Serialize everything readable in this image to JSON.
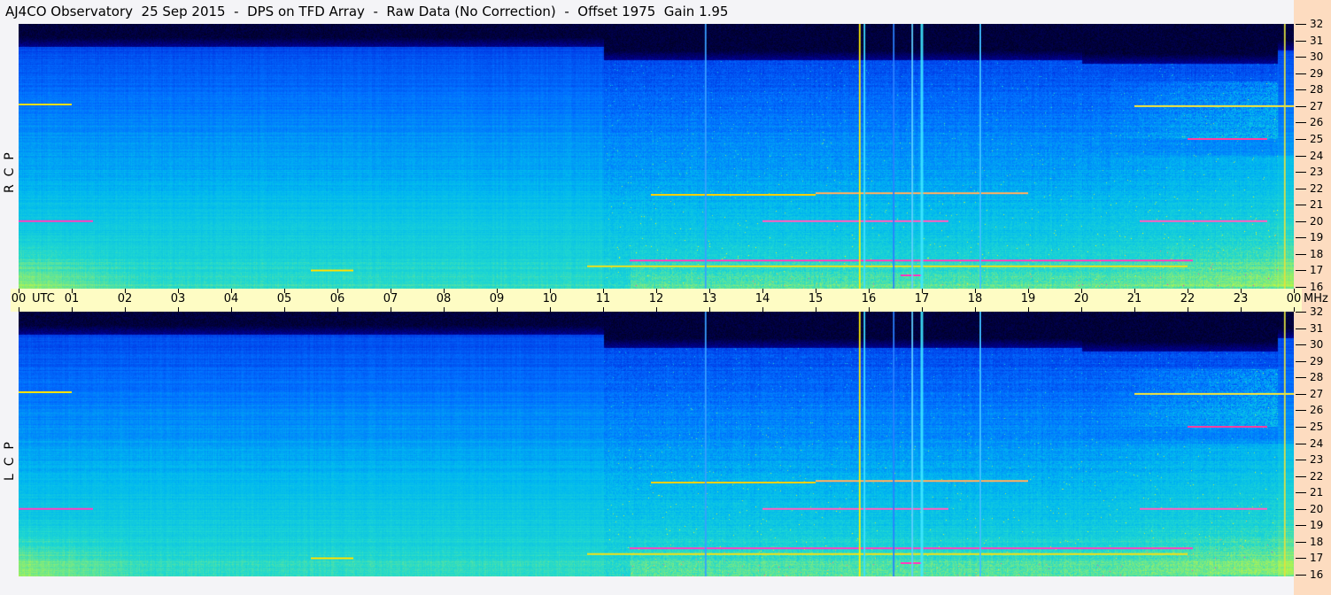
{
  "title": "AJ4CO Observatory  25 Sep 2015  -  DPS on TFD Array  -  Raw Data (No Correction)  -  Offset 1975  Gain 1.95",
  "chart_data": {
    "type": "heatmap",
    "title": "AJ4CO Observatory  25 Sep 2015  -  DPS on TFD Array  -  Raw Data (No Correction)  -  Offset 1975  Gain 1.95",
    "panels": [
      {
        "label": "R  C  P",
        "polarization": "RCP"
      },
      {
        "label": "L  C  P",
        "polarization": "LCP"
      }
    ],
    "x_unit_label": "UTC",
    "y_unit_label": "MHz",
    "x_range_utc_hours": [
      0,
      24
    ],
    "y_range_mhz": [
      16,
      32
    ],
    "x_ticks": [
      "00",
      "01",
      "02",
      "03",
      "04",
      "05",
      "06",
      "07",
      "08",
      "09",
      "10",
      "11",
      "12",
      "13",
      "14",
      "15",
      "16",
      "17",
      "18",
      "19",
      "20",
      "21",
      "22",
      "23",
      "00"
    ],
    "y_ticks": [
      "32",
      "31",
      "30",
      "29",
      "28",
      "27",
      "26",
      "25",
      "24",
      "23",
      "22",
      "21",
      "20",
      "19",
      "18",
      "17",
      "16"
    ],
    "colormap": [
      "#000010",
      "#00008a",
      "#0030e0",
      "#0070ff",
      "#00b8f0",
      "#20d8d0",
      "#a0f060",
      "#ffff00",
      "#ff00ff"
    ],
    "vertical_interference_utc": [
      {
        "utc": 12.93,
        "color": "#3aa0ff"
      },
      {
        "utc": 15.83,
        "color": "#ffee00"
      },
      {
        "utc": 15.92,
        "color": "#40e0ff"
      },
      {
        "utc": 16.47,
        "color": "#2a80ff"
      },
      {
        "utc": 16.82,
        "color": "#60d0ff"
      },
      {
        "utc": 17.0,
        "color": "#40e8ff"
      },
      {
        "utc": 18.1,
        "color": "#40c0ff"
      },
      {
        "utc": 23.83,
        "color": "#e0e040"
      }
    ],
    "horizontal_signals": [
      {
        "freq_mhz": 27.1,
        "start_utc": 0.0,
        "end_utc": 1.0,
        "color": "#ffe000"
      },
      {
        "freq_mhz": 20.0,
        "start_utc": 0.0,
        "end_utc": 1.4,
        "color": "#ff40c0"
      },
      {
        "freq_mhz": 17.6,
        "start_utc": 11.5,
        "end_utc": 22.1,
        "color": "#ff40c0"
      },
      {
        "freq_mhz": 17.25,
        "start_utc": 10.7,
        "end_utc": 22.0,
        "color": "#e8e020"
      },
      {
        "freq_mhz": 21.6,
        "start_utc": 11.9,
        "end_utc": 15.0,
        "color": "#ffd000"
      },
      {
        "freq_mhz": 21.7,
        "start_utc": 15.0,
        "end_utc": 19.0,
        "color": "#ffb060"
      },
      {
        "freq_mhz": 20.0,
        "start_utc": 14.0,
        "end_utc": 17.5,
        "color": "#ff60c0"
      },
      {
        "freq_mhz": 20.0,
        "start_utc": 21.1,
        "end_utc": 23.5,
        "color": "#ff60c0"
      },
      {
        "freq_mhz": 25.0,
        "start_utc": 22.0,
        "end_utc": 23.5,
        "color": "#ff40a0"
      },
      {
        "freq_mhz": 27.0,
        "start_utc": 21.0,
        "end_utc": 24.0,
        "color": "#f0e040"
      },
      {
        "freq_mhz": 17.0,
        "start_utc": 5.5,
        "end_utc": 6.3,
        "color": "#ffe000"
      },
      {
        "freq_mhz": 16.7,
        "start_utc": 16.6,
        "end_utc": 17.0,
        "color": "#ff40c0"
      }
    ]
  }
}
